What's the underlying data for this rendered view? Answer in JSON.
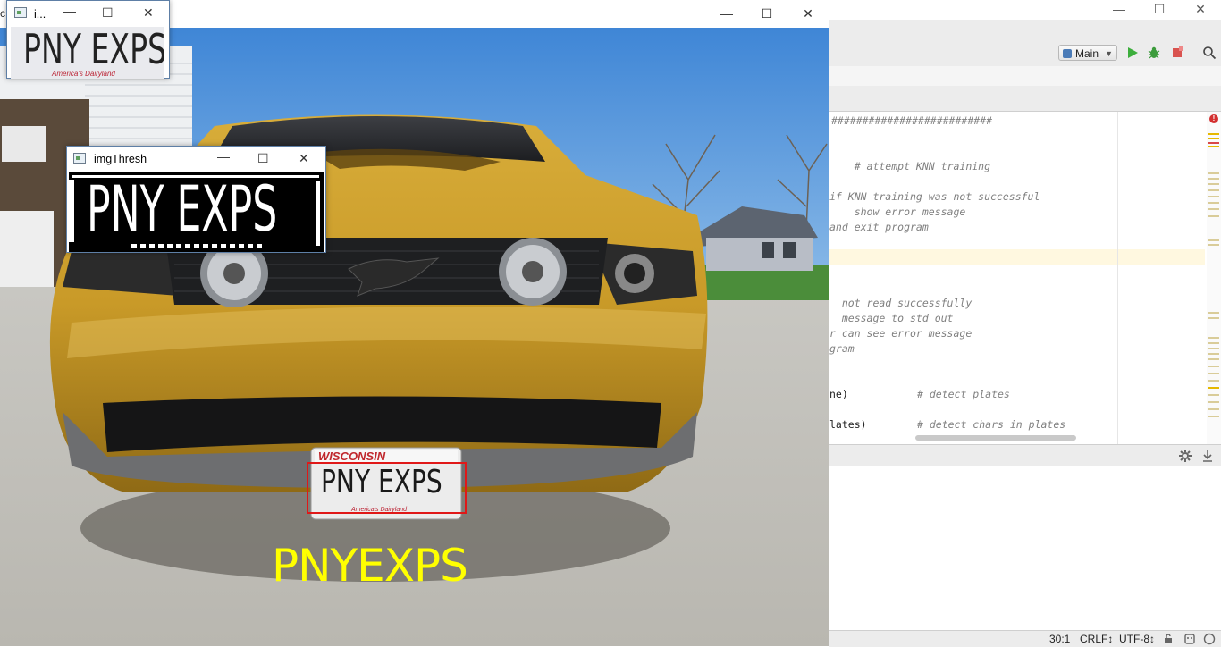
{
  "ide": {
    "run_config": "Main",
    "code_lines": [
      {
        "text": "##########################",
        "kind": "comment"
      },
      {
        "text": "    # attempt KNN training",
        "kind": "comment"
      },
      {
        "text": "if KNN training was not successful",
        "kind": "comment"
      },
      {
        "text": "    show error message",
        "kind": "comment"
      },
      {
        "text": "and exit program",
        "kind": "comment"
      },
      {
        "text": "  not read successfully",
        "kind": "comment"
      },
      {
        "text": "  message to std out",
        "kind": "comment"
      },
      {
        "text": "r can see error message",
        "kind": "comment"
      },
      {
        "text": "gram",
        "kind": "comment"
      },
      {
        "text": "ne)",
        "kind": "code"
      },
      {
        "text": "# detect plates",
        "kind": "comment"
      },
      {
        "text": "lates)",
        "kind": "code"
      },
      {
        "text": "# detect chars in plates",
        "kind": "comment"
      }
    ],
    "status": {
      "position": "30:1",
      "line_sep": "CRLF↕",
      "encoding": "UTF-8↕"
    }
  },
  "main_window": {
    "title_letter": "c",
    "minimize_glyph": "—",
    "maximize_glyph": "☐",
    "close_glyph": "✕"
  },
  "plate_window": {
    "title": "i...",
    "plate_text": "PNY EXPS",
    "plate_subtext": "America's Dairyland"
  },
  "thresh_window": {
    "title": "imgThresh",
    "plate_text": "PNY EXPS"
  },
  "scene": {
    "plate_state": "WISCONSIN",
    "plate_text": "PNY EXPS",
    "plate_subtext": "America's Dairyland",
    "recognized_text": "PNYEXPS",
    "colors": {
      "sky": "#4d8fd8",
      "car": "#c79a2c",
      "ground": "#c8c6c0",
      "detection_box": "#e01818",
      "recognized_text": "#ffff00"
    }
  }
}
